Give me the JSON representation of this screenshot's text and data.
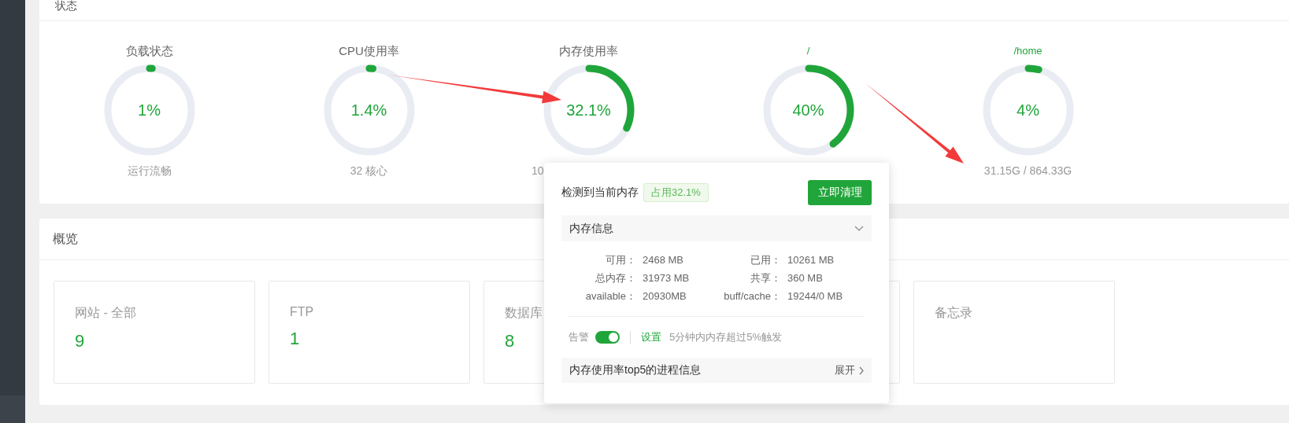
{
  "status_panel": {
    "title": "状态",
    "gauges": [
      {
        "kind": "load",
        "title": "负载状态",
        "reading": "1%",
        "level": 0.01,
        "subtitle": "运行流畅"
      },
      {
        "kind": "cpu",
        "title": "CPU使用率",
        "reading": "1.4%",
        "level": 0.014,
        "subtitle": "32 核心"
      },
      {
        "kind": "memory",
        "title": "内存使用率",
        "reading": "32.1%",
        "level": 0.321,
        "subtitle": "10"
      },
      {
        "kind": "disk",
        "title": "/",
        "reading": "40%",
        "level": 0.4
      },
      {
        "kind": "disk",
        "title": "/home",
        "reading": "4%",
        "level": 0.04,
        "subtitle": "31.15G / 864.33G"
      }
    ]
  },
  "overview_panel": {
    "title": "概览",
    "cards": [
      {
        "kind": "stat",
        "label": "网站 - 全部",
        "value": "9"
      },
      {
        "kind": "stat",
        "label": "FTP",
        "value": "1"
      },
      {
        "kind": "stat",
        "label": "数据库",
        "value": "8"
      },
      {
        "kind": "hidden"
      },
      {
        "kind": "stat",
        "label": "备忘录"
      }
    ]
  },
  "memory_popup": {
    "heading": "检测到当前内存",
    "usage_badge": "占用32.1%",
    "clean_button": "立即清理",
    "info_section": {
      "title": "内存信息",
      "stats": [
        {
          "label": "可用：",
          "value": "2468 MB"
        },
        {
          "label": "已用：",
          "value": "10261 MB"
        },
        {
          "label": "总内存：",
          "value": "31973 MB"
        },
        {
          "label": "共享：",
          "value": "360 MB"
        },
        {
          "label": "available：",
          "value": "20930MB"
        },
        {
          "label": "buff/cache：",
          "value": "19244/0 MB"
        }
      ]
    },
    "alarm": {
      "label": "告警",
      "on": true,
      "settings_link": "设置",
      "rule": "5分钟内内存超过5%触发"
    },
    "top_processes": {
      "title": "内存使用率top5的进程信息",
      "toggle": "展开"
    }
  }
}
